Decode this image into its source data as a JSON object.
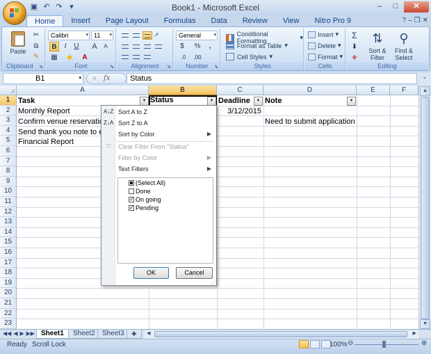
{
  "window": {
    "title": "Book1 - Microsoft Excel",
    "controls": [
      "–",
      "□",
      "✕"
    ]
  },
  "quick_access": [
    "save-icon",
    "undo-icon",
    "redo-icon",
    "customize-icon"
  ],
  "ribbon_tabs": [
    "Home",
    "Insert",
    "Page Layout",
    "Formulas",
    "Data",
    "Review",
    "View",
    "Nitro Pro 9"
  ],
  "ribbon": {
    "clipboard": {
      "label": "Clipboard",
      "paste": "Paste"
    },
    "font": {
      "label": "Font",
      "name": "Calibri",
      "size": "11",
      "bold": "B",
      "italic": "I",
      "underline": "U",
      "grow": "A",
      "shrink": "A"
    },
    "alignment": {
      "label": "Alignment"
    },
    "number": {
      "label": "Number",
      "format": "General",
      "currency": "$",
      "percent": "%",
      "comma": ","
    },
    "styles": {
      "label": "Styles",
      "conditional": "Conditional Formatting",
      "table": "Format as Table",
      "cell": "Cell Styles"
    },
    "cells": {
      "label": "Cells",
      "insert": "Insert",
      "delete": "Delete",
      "format": "Format"
    },
    "editing": {
      "label": "Editing",
      "sum": "Σ",
      "sort": "Sort &",
      "sort2": "Filter",
      "find": "Find &",
      "find2": "Select"
    }
  },
  "formula_bar": {
    "name_box": "B1",
    "content": "Status"
  },
  "columns": [
    "A",
    "B",
    "C",
    "D",
    "E",
    "F"
  ],
  "rows": [
    "1",
    "2",
    "3",
    "4",
    "5",
    "6",
    "7",
    "8",
    "9",
    "10",
    "11",
    "12",
    "13",
    "14",
    "15",
    "16",
    "17",
    "18",
    "19",
    "20",
    "21",
    "22",
    "23"
  ],
  "headers": {
    "task": "Task",
    "status": "Status",
    "deadline": "Deadline",
    "note": "Note"
  },
  "cells": {
    "a2": "Monthly Report",
    "a3": "Confirm venue reservation",
    "a4": "Send thank you note to eve",
    "a5": "Financial Report",
    "c2": "3/12/2015",
    "d3": "Need to submit application"
  },
  "filter_menu": {
    "sort_az": "Sort A to Z",
    "sort_za": "Sort Z to A",
    "sort_color": "Sort by Color",
    "clear_filter": "Clear Filter From \"Status\"",
    "filter_color": "Filter by Color",
    "text_filters": "Text Filters",
    "options": [
      {
        "label": "(Select All)",
        "state": "partial"
      },
      {
        "label": "Done",
        "state": "unchecked"
      },
      {
        "label": "On going",
        "state": "checked"
      },
      {
        "label": "Pending",
        "state": "checked"
      }
    ],
    "ok": "OK",
    "cancel": "Cancel"
  },
  "sheet_tabs": [
    "Sheet1",
    "Sheet2",
    "Sheet3"
  ],
  "status": {
    "ready": "Ready",
    "scroll_lock": "Scroll Lock",
    "zoom": "100%"
  },
  "colors": {
    "accent": "#f7c04c",
    "ribbon": "#dbe7f5",
    "header_selected": "#f5c569"
  }
}
